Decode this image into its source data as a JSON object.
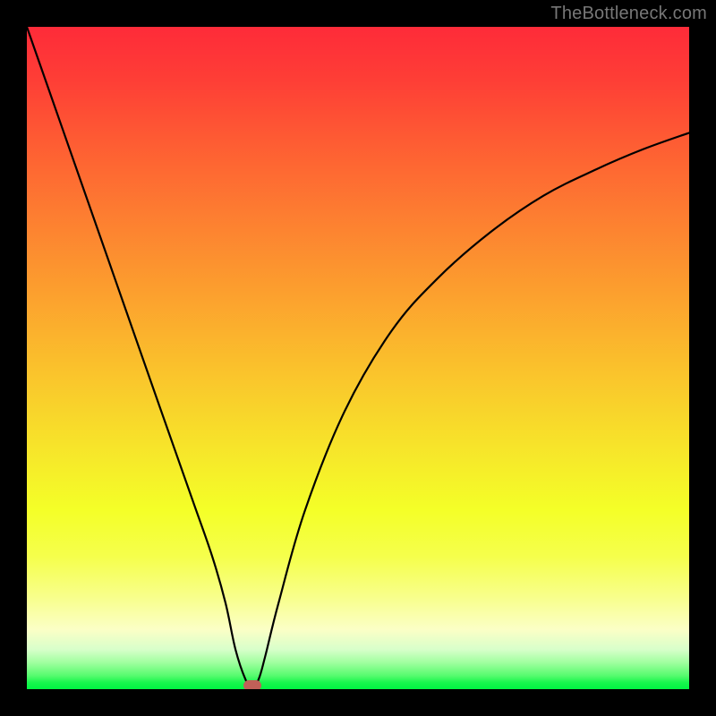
{
  "watermark": "TheBottleneck.com",
  "colors": {
    "frame": "#000000",
    "curve": "#000000",
    "marker": "#c06058"
  },
  "chart_data": {
    "type": "line",
    "title": "",
    "xlabel": "",
    "ylabel": "",
    "xlim": [
      0,
      100
    ],
    "ylim": [
      0,
      100
    ],
    "series": [
      {
        "name": "bottleneck-curve",
        "x": [
          0,
          5,
          10,
          15,
          20,
          25,
          28,
          30,
          31.5,
          33,
          34,
          35,
          36,
          38,
          42,
          48,
          55,
          62,
          70,
          78,
          86,
          93,
          100
        ],
        "y": [
          100,
          85.7,
          71.4,
          57.1,
          42.8,
          28.6,
          20,
          13,
          6,
          1.5,
          0.2,
          1.5,
          5,
          13,
          27,
          42,
          54,
          62,
          69,
          74.5,
          78.5,
          81.5,
          84
        ]
      }
    ],
    "marker": {
      "x": 34,
      "y": 0.5
    },
    "gradient_stops": [
      {
        "pos": 0,
        "color": "#fe2b39"
      },
      {
        "pos": 50,
        "color": "#fac32c"
      },
      {
        "pos": 85,
        "color": "#f8ff8a"
      },
      {
        "pos": 100,
        "color": "#00f342"
      }
    ]
  }
}
